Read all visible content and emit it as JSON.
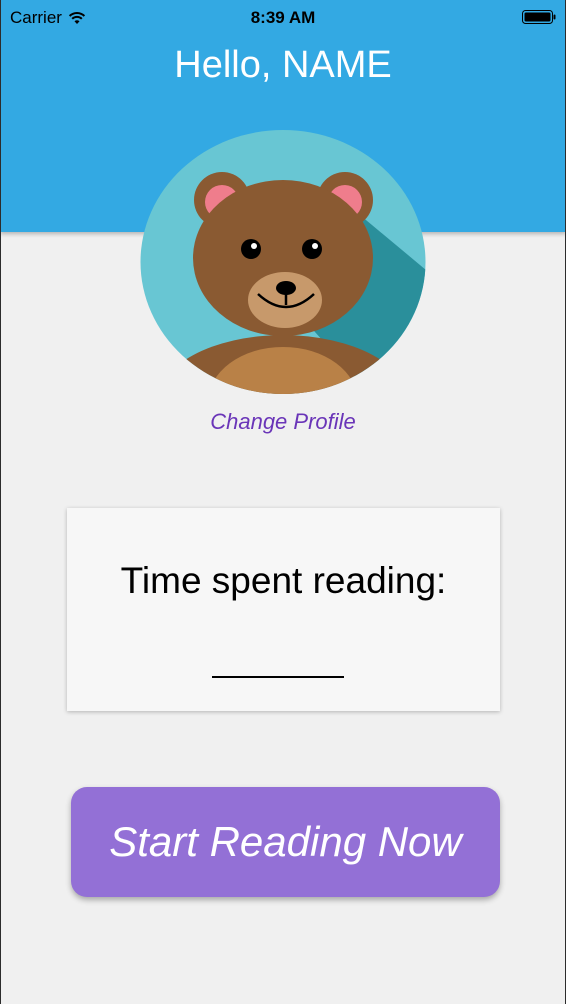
{
  "status_bar": {
    "carrier": "Carrier",
    "time": "8:39 AM",
    "wifi_icon": "wifi-icon",
    "battery_icon": "battery-icon"
  },
  "header": {
    "greeting": "Hello, NAME",
    "background_color": "#33a9e3"
  },
  "profile": {
    "avatar_icon": "teddy-bear-avatar",
    "change_label": "Change Profile"
  },
  "reading_card": {
    "label": "Time spent reading:",
    "value": ""
  },
  "start_button": {
    "label": "Start Reading Now",
    "color": "#9370d6"
  },
  "colors": {
    "accent_purple": "#6a35b8",
    "page_background": "#f0f0f0"
  }
}
